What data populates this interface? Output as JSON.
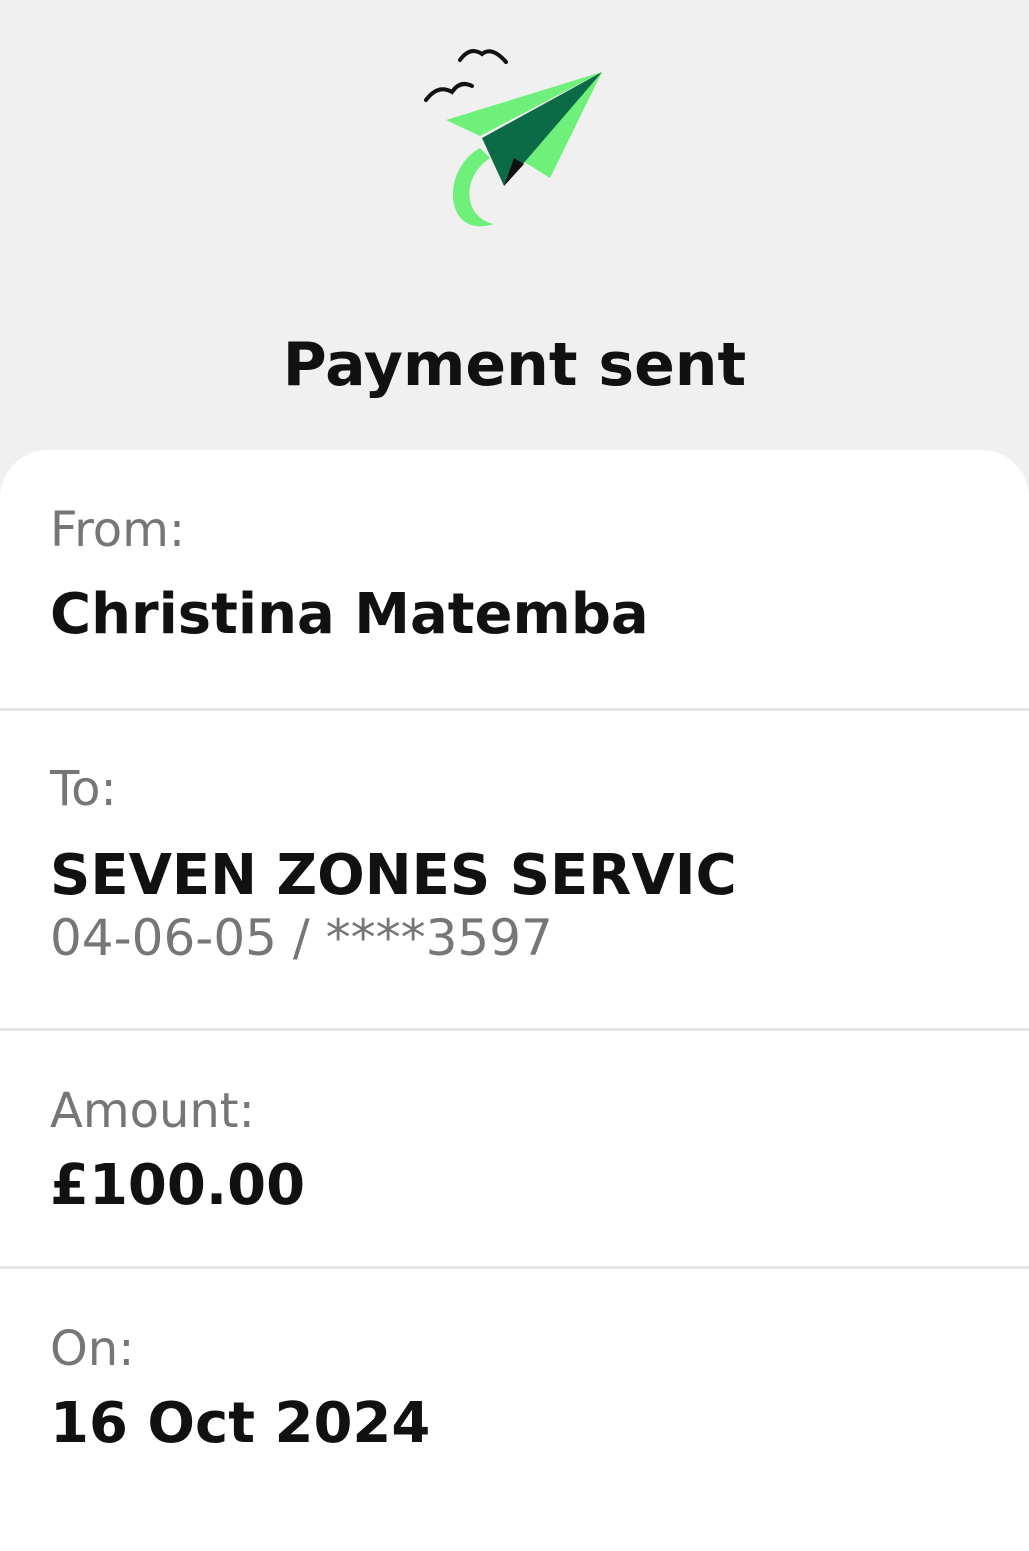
{
  "header": {
    "title": "Payment sent",
    "logo_icon": "paper-plane-birds-icon"
  },
  "details": {
    "from": {
      "label": "From:",
      "value": "Christina Matemba"
    },
    "to": {
      "label": "To:",
      "value": "SEVEN ZONES SERVIC",
      "account": "04-06-05 / ****3597"
    },
    "amount": {
      "label": "Amount:",
      "value": "£100.00"
    },
    "on": {
      "label": "On:",
      "value": "16 Oct 2024"
    }
  },
  "colors": {
    "background": "#f0f0f0",
    "card": "#ffffff",
    "plane_light_green": "#6ef07a",
    "plane_dark_green": "#0b6b47",
    "label_gray": "#767676",
    "text": "#111111"
  }
}
